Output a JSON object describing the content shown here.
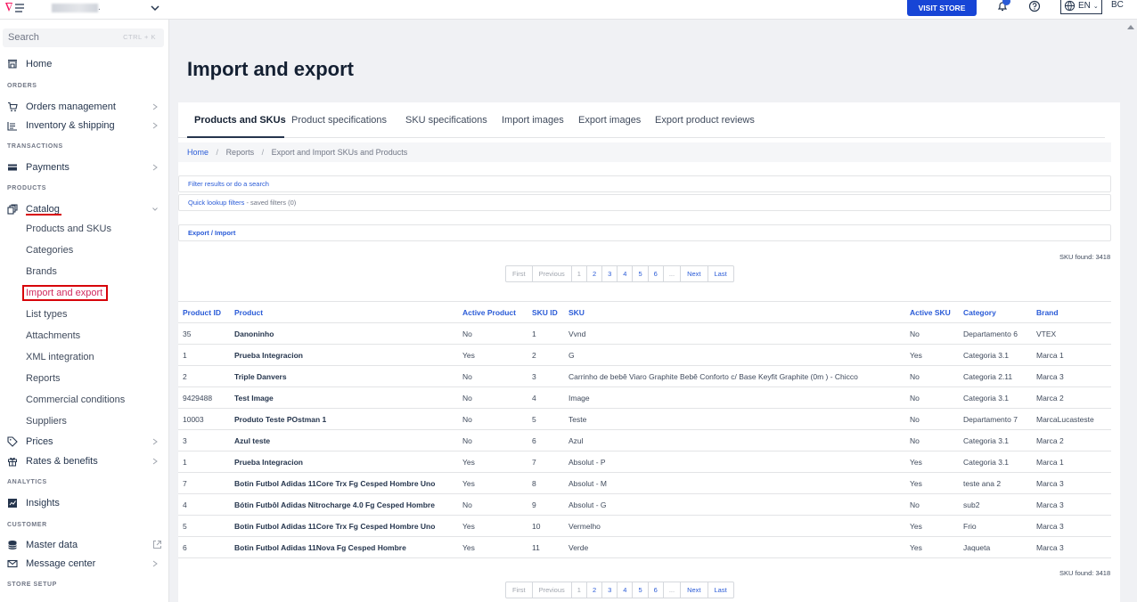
{
  "topbar": {
    "visit_store": "VISIT STORE",
    "lang": "EN",
    "user_initials": "BC"
  },
  "sidebar": {
    "search_placeholder": "Search",
    "search_shortcut": "CTRL + K",
    "home": "Home",
    "sections": {
      "orders": "ORDERS",
      "transactions": "TRANSACTIONS",
      "products": "PRODUCTS",
      "analytics": "ANALYTICS",
      "customer": "CUSTOMER",
      "store_setup": "STORE SETUP"
    },
    "orders_management": "Orders management",
    "inventory_shipping": "Inventory & shipping",
    "payments": "Payments",
    "catalog": "Catalog",
    "catalog_items": [
      "Products and SKUs",
      "Categories",
      "Brands",
      "Import and export",
      "List types",
      "Attachments",
      "XML integration",
      "Reports",
      "Commercial conditions",
      "Suppliers"
    ],
    "prices": "Prices",
    "rates_benefits": "Rates & benefits",
    "insights": "Insights",
    "master_data": "Master data",
    "message_center": "Message center"
  },
  "main": {
    "title": "Import and export",
    "tabs": [
      "Products and SKUs",
      "Product specifications",
      "SKU specifications",
      "Import images",
      "Export images",
      "Export product reviews"
    ],
    "breadcrumb": [
      "Home",
      "Reports",
      "Export and Import SKUs and Products"
    ],
    "filter_link": "Filter results or do a search",
    "quick_lookup": "Quick lookup filters",
    "saved_filters": " - saved filters (0)",
    "export_import": "Export / Import",
    "sku_found": "SKU found: 3418",
    "pager": [
      "First",
      "Previous",
      "1",
      "2",
      "3",
      "4",
      "5",
      "6",
      "...",
      "Next",
      "Last"
    ]
  },
  "table": {
    "headers": [
      "Product ID",
      "Product",
      "Active Product",
      "SKU ID",
      "SKU",
      "Active SKU",
      "Category",
      "Brand"
    ],
    "rows": [
      [
        "35",
        "Danoninho",
        "No",
        "1",
        "Vvnd",
        "No",
        "Departamento 6",
        "VTEX"
      ],
      [
        "1",
        "Prueba Integracion",
        "Yes",
        "2",
        "G",
        "Yes",
        "Categoria 3.1",
        "Marca 1"
      ],
      [
        "2",
        "Triple Danvers",
        "No",
        "3",
        "Carrinho de bebê Viaro Graphite Bebê Conforto c/ Base Keyfit Graphite (0m ) - Chicco",
        "No",
        "Categoria 2.11",
        "Marca 3"
      ],
      [
        "9429488",
        "Test Image",
        "No",
        "4",
        "Image",
        "No",
        "Categoria 3.1",
        "Marca 2"
      ],
      [
        "10003",
        "Produto Teste POstman 1",
        "No",
        "5",
        "Teste",
        "No",
        "Departamento 7",
        "MarcaLucasteste"
      ],
      [
        "3",
        "Azul teste",
        "No",
        "6",
        "Azul",
        "No",
        "Categoria 3.1",
        "Marca 2"
      ],
      [
        "1",
        "Prueba Integracion",
        "Yes",
        "7",
        "Absolut - P",
        "Yes",
        "Categoria 3.1",
        "Marca 1"
      ],
      [
        "7",
        "Botin Futbol Adidas 11Core Trx Fg Cesped Hombre Uno",
        "Yes",
        "8",
        "Absolut - M",
        "Yes",
        "teste ana 2",
        "Marca 3"
      ],
      [
        "4",
        "Bótin Futbôl Adidas Nitrocharge 4.0 Fg Cesped Hombre",
        "No",
        "9",
        "Absolut - G",
        "No",
        "sub2",
        "Marca 3"
      ],
      [
        "5",
        "Botin Futbol Adidas 11Core Trx Fg Cesped Hombre Uno",
        "Yes",
        "10",
        "Vermelho",
        "Yes",
        "Frio",
        "Marca 3"
      ],
      [
        "6",
        "Botin Futbol Adidas 11Nova Fg Cesped Hombre",
        "Yes",
        "11",
        "Verde",
        "Yes",
        "Jaqueta",
        "Marca 3"
      ]
    ]
  },
  "colors": {
    "accent_blue": "#1745d6",
    "link_blue": "#2a5bd7",
    "active_red": "#d7040a",
    "active_pink": "#d02a5e"
  }
}
